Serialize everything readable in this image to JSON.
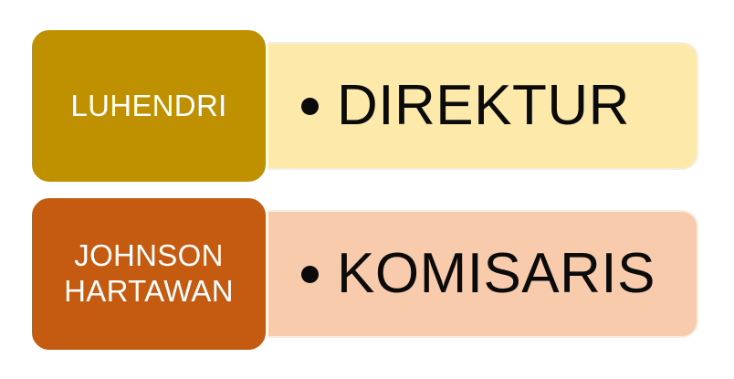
{
  "rows": [
    {
      "label_lines": [
        "LUHENDRI"
      ],
      "detail": "DIREKTUR",
      "label_color": "#bf9000",
      "detail_color": "#fde9a9"
    },
    {
      "label_lines": [
        "JOHNSON",
        "HARTAWAN"
      ],
      "detail": "KOMISARIS",
      "label_color": "#c55a11",
      "detail_color": "#f8cbad"
    }
  ]
}
